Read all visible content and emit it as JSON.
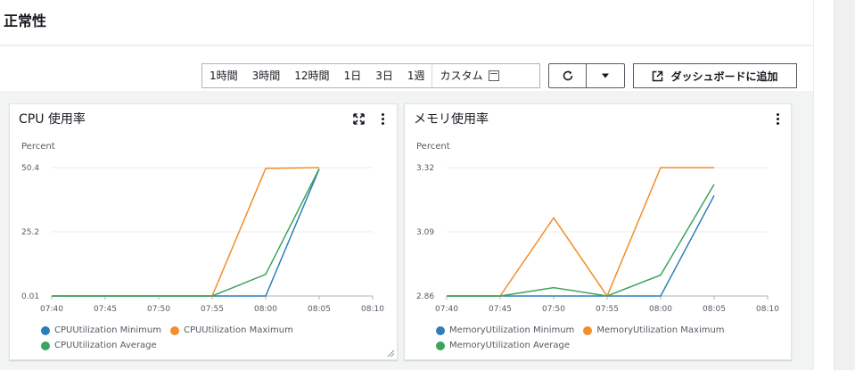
{
  "page": {
    "title": "正常性"
  },
  "toolbar": {
    "ranges": [
      "1時間",
      "3時間",
      "12時間",
      "1日",
      "3日",
      "1週"
    ],
    "custom_label": "カスタム",
    "add_label": "ダッシュボードに追加",
    "icons": {
      "refresh": "refresh-icon",
      "dropdown": "caret-down-icon",
      "external": "external-link-icon",
      "calendar": "calendar-icon"
    }
  },
  "widgets": {
    "cpu": {
      "title": "CPU 使用率",
      "unit": "Percent"
    },
    "mem": {
      "title": "メモリ使用率",
      "unit": "Percent"
    }
  },
  "colors": {
    "blue": "#2c7fb8",
    "orange": "#f28e2b",
    "green": "#3ba55c",
    "grid": "#e9ebed"
  },
  "chart_data": [
    {
      "type": "line",
      "title": "CPU 使用率",
      "ylabel": "Percent",
      "x": [
        "07:40",
        "07:45",
        "07:50",
        "07:55",
        "08:00",
        "08:05",
        "08:10"
      ],
      "ylim": [
        0.01,
        50.4
      ],
      "yticks": [
        "0.01",
        "25.2",
        "50.4"
      ],
      "legend_position": "bottom",
      "series": [
        {
          "name": "CPUUtilization Minimum",
          "color": "#2c7fb8",
          "points": [
            [
              "07:40",
              0.01
            ],
            [
              "07:45",
              0.01
            ],
            [
              "07:50",
              0.01
            ],
            [
              "07:55",
              0.01
            ],
            [
              "08:00",
              0.01
            ],
            [
              "08:05",
              49.8
            ]
          ]
        },
        {
          "name": "CPUUtilization Maximum",
          "color": "#f28e2b",
          "points": [
            [
              "07:40",
              0.01
            ],
            [
              "07:45",
              0.01
            ],
            [
              "07:50",
              0.01
            ],
            [
              "07:55",
              0.01
            ],
            [
              "08:00",
              50.1
            ],
            [
              "08:05",
              50.4
            ]
          ]
        },
        {
          "name": "CPUUtilization Average",
          "color": "#3ba55c",
          "points": [
            [
              "07:40",
              0.01
            ],
            [
              "07:45",
              0.01
            ],
            [
              "07:50",
              0.01
            ],
            [
              "07:55",
              0.01
            ],
            [
              "08:00",
              8.5
            ],
            [
              "08:05",
              49.9
            ]
          ]
        }
      ]
    },
    {
      "type": "line",
      "title": "メモリ使用率",
      "ylabel": "Percent",
      "x": [
        "07:40",
        "07:45",
        "07:50",
        "07:55",
        "08:00",
        "08:05",
        "08:10"
      ],
      "ylim": [
        2.86,
        3.32
      ],
      "yticks": [
        "2.86",
        "3.09",
        "3.32"
      ],
      "legend_position": "bottom",
      "series": [
        {
          "name": "MemoryUtilization Minimum",
          "color": "#2c7fb8",
          "points": [
            [
              "07:40",
              2.86
            ],
            [
              "07:45",
              2.86
            ],
            [
              "07:50",
              2.86
            ],
            [
              "07:55",
              2.86
            ],
            [
              "08:00",
              2.86
            ],
            [
              "08:05",
              3.22
            ]
          ]
        },
        {
          "name": "MemoryUtilization Maximum",
          "color": "#f28e2b",
          "points": [
            [
              "07:40",
              2.86
            ],
            [
              "07:45",
              2.86
            ],
            [
              "07:50",
              3.14
            ],
            [
              "07:55",
              2.86
            ],
            [
              "08:00",
              3.32
            ],
            [
              "08:05",
              3.32
            ]
          ]
        },
        {
          "name": "MemoryUtilization Average",
          "color": "#3ba55c",
          "points": [
            [
              "07:40",
              2.86
            ],
            [
              "07:45",
              2.86
            ],
            [
              "07:50",
              2.89
            ],
            [
              "07:55",
              2.86
            ],
            [
              "08:00",
              2.935
            ],
            [
              "08:05",
              3.26
            ]
          ]
        }
      ]
    }
  ]
}
